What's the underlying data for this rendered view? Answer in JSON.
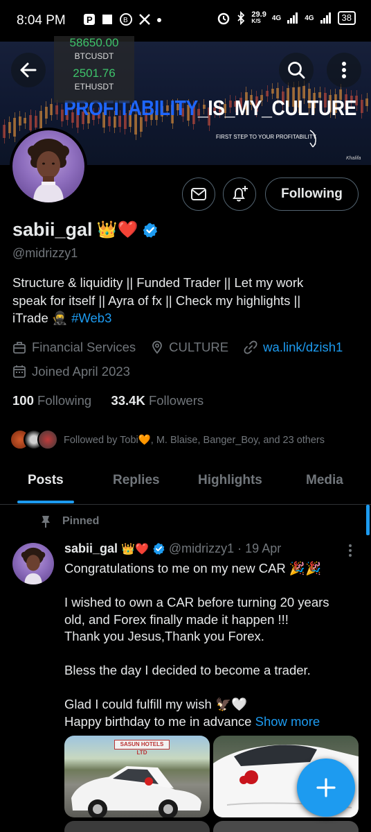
{
  "status_bar": {
    "time": "8:04 PM",
    "net_speed": "29.9",
    "net_unit": "K/S",
    "net_type_1": "4G",
    "net_type_2": "4G",
    "battery": "38"
  },
  "banner": {
    "ticker": [
      {
        "price": "58650.00",
        "symbol": "BTCUSDT"
      },
      {
        "price": "2501.76",
        "symbol": "ETHUSDT"
      }
    ],
    "title_part_1": "PROFITABILITY",
    "title_part_2": "_IS_MY_CULTURE",
    "subtitle": "FIRST STEP TO YOUR PROFITABILITY",
    "signature": "Khalifa"
  },
  "profile": {
    "name": "sabii_gal",
    "name_emoji": "👑❤️",
    "handle": "@midrizzy1",
    "follow_button": "Following",
    "bio_lines": [
      "Structure & liquidity || Funded Trader || Let my work",
      "speak for itself || Ayra of fx || Check my highlights ||",
      "iTrade 🥷 "
    ],
    "bio_hashtag": "#Web3",
    "category": "Financial Services",
    "location": "CULTURE",
    "link": "wa.link/dzish1",
    "joined": "Joined April 2023",
    "following_count": "100",
    "following_label": "Following",
    "followers_count": "33.4K",
    "followers_label": "Followers",
    "followed_by": "Followed by Tobi🧡, M. Blaise, Banger_Boy, and 23 others"
  },
  "tabs": [
    "Posts",
    "Replies",
    "Highlights",
    "Media"
  ],
  "post": {
    "pinned_label": "Pinned",
    "author_name": "sabii_gal",
    "author_emoji": "👑❤️",
    "author_handle": "@midrizzy1",
    "date": "· 19 Apr",
    "lines": [
      "Congratulations to me on my new CAR 🎉🎉",
      "",
      "I wished to own a CAR before turning 20 years",
      "old, and Forex finally made it happen !!!",
      "Thank you Jesus,Thank you Forex.",
      "",
      "Bless the day I decided to become a trader.",
      "",
      "Glad I could fulfill my wish 🦅🤍",
      "Happy birthday to me in advance "
    ],
    "show_more": "Show more",
    "photo_sign": "SASUN HOTELS LTD"
  },
  "colors": {
    "accent": "#1d9bf0",
    "muted": "#71767b",
    "text": "#e7e9ea",
    "border": "#2f3336"
  },
  "icons": [
    "back-arrow-icon",
    "search-icon",
    "more-vertical-icon",
    "message-icon",
    "bell-plus-icon",
    "verified-badge-icon",
    "briefcase-icon",
    "location-icon",
    "link-icon",
    "calendar-icon",
    "pin-icon",
    "plus-icon"
  ]
}
